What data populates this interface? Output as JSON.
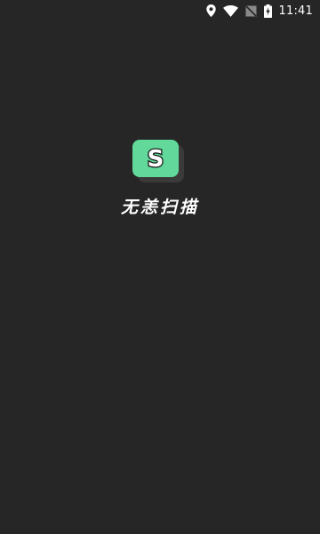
{
  "status_bar": {
    "time": "11:41",
    "icons": [
      "location-icon",
      "wifi-icon",
      "no-sim-icon",
      "battery-charging-icon"
    ]
  },
  "app": {
    "logo_letter": "S",
    "title": "无恙扫描"
  },
  "colors": {
    "background": "#262626",
    "logo_green": "#62d99a",
    "text": "#ffffff"
  }
}
